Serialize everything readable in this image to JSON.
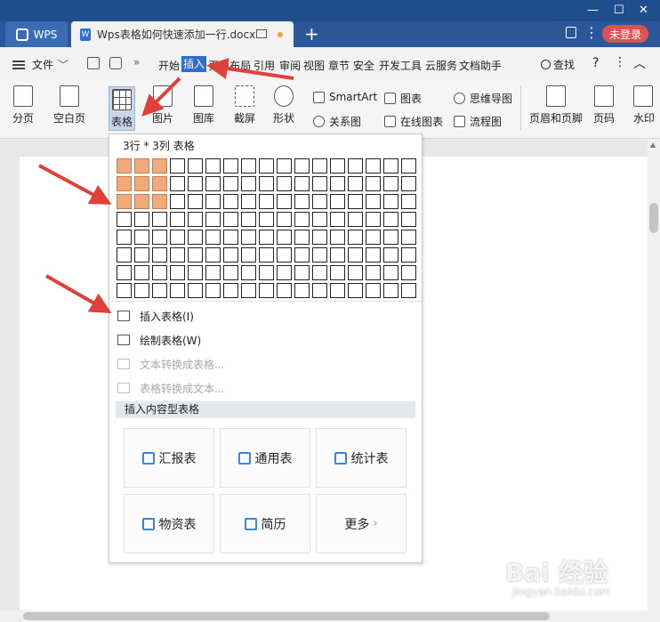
{
  "titlebar": {
    "app_tab": "WPS",
    "doc_tab": "Wps表格如何快速添加一行.docx",
    "new_tab": "+",
    "login": "未登录"
  },
  "menubar": {
    "file": "文件",
    "items": [
      "开始",
      "插入",
      "页面布局",
      "引用",
      "审阅",
      "视图",
      "章节",
      "安全",
      "开发工具",
      "云服务",
      "文档助手"
    ],
    "active_item": "插入",
    "search": "查找"
  },
  "ribbon": {
    "big_buttons": [
      {
        "label": "分页",
        "icon": "page-break-icon"
      },
      {
        "label": "空白页",
        "icon": "blank-page-icon"
      },
      {
        "label": "表格",
        "icon": "table-icon"
      },
      {
        "label": "图片",
        "icon": "picture-icon"
      },
      {
        "label": "图库",
        "icon": "gallery-icon"
      },
      {
        "label": "截屏",
        "icon": "screenshot-icon"
      },
      {
        "label": "形状",
        "icon": "shape-icon"
      }
    ],
    "small_buttons": [
      {
        "label": "SmartArt",
        "icon": "smartart-icon"
      },
      {
        "label": "关系图",
        "icon": "relation-icon"
      },
      {
        "label": "图表",
        "icon": "chart-icon"
      },
      {
        "label": "在线图表",
        "icon": "online-chart-icon"
      },
      {
        "label": "思维导图",
        "icon": "mindmap-icon"
      },
      {
        "label": "流程图",
        "icon": "flowchart-icon"
      }
    ],
    "right_buttons": [
      {
        "label": "页眉和页脚",
        "icon": "header-footer-icon"
      },
      {
        "label": "页码",
        "icon": "page-number-icon"
      },
      {
        "label": "水印",
        "icon": "watermark-icon"
      }
    ]
  },
  "dropdown": {
    "header": "3行 * 3列 表格",
    "grid": {
      "cols": 17,
      "rows": 8,
      "selected_rows": 3,
      "selected_cols": 3
    },
    "items": [
      {
        "label": "插入表格(I)",
        "enabled": true
      },
      {
        "label": "绘制表格(W)",
        "enabled": true
      },
      {
        "label": "文本转换成表格...",
        "enabled": false
      },
      {
        "label": "表格转换成文本...",
        "enabled": false
      }
    ],
    "section_title": "插入内容型表格",
    "cards": [
      "汇报表",
      "通用表",
      "统计表",
      "物资表",
      "简历",
      "更多"
    ]
  },
  "watermark": {
    "main": "Bai 经验",
    "url": "jingyan.baidu.com"
  },
  "colors": {
    "accent": "#2b579a",
    "highlight_cell": "#f2aa7a",
    "arrow": "#e0403a",
    "login": "#e05252"
  }
}
